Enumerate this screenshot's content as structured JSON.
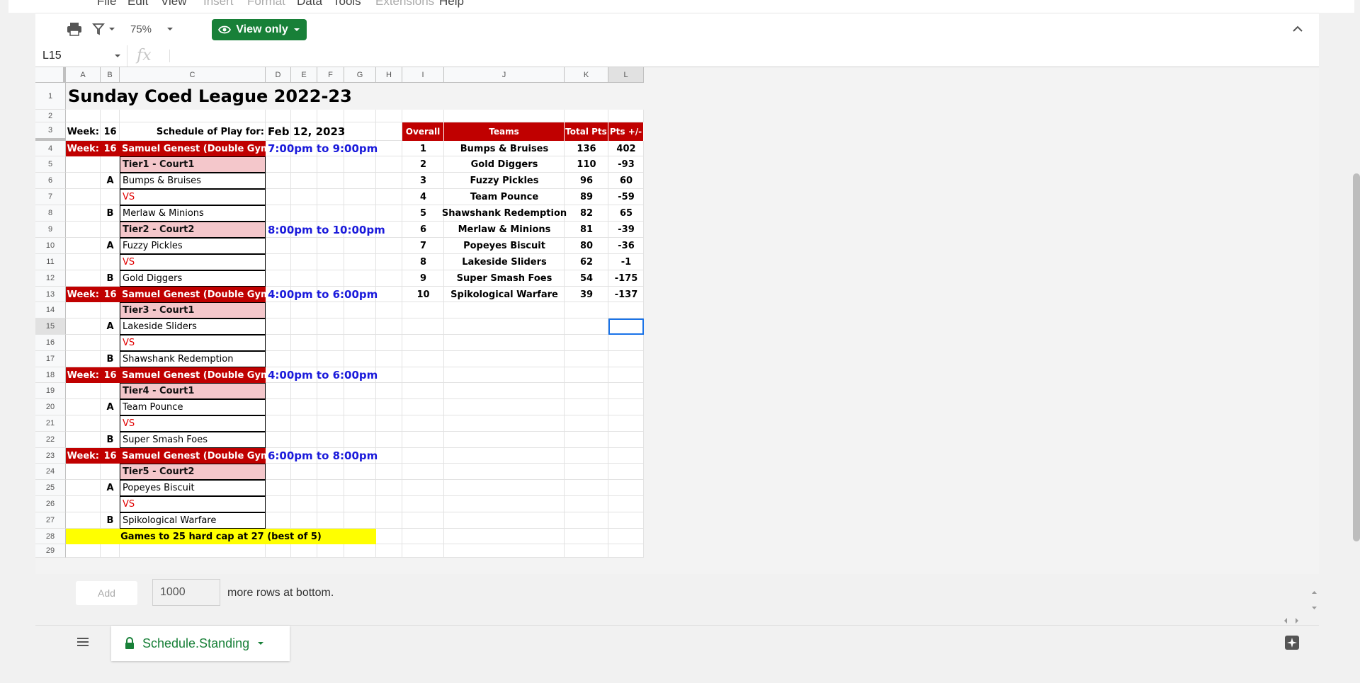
{
  "menu": {
    "items": [
      {
        "label": "File",
        "enabled": true
      },
      {
        "label": "Edit",
        "enabled": true
      },
      {
        "label": "View",
        "enabled": true
      },
      {
        "label": "Insert",
        "enabled": false
      },
      {
        "label": "Format",
        "enabled": false
      },
      {
        "label": "Data",
        "enabled": true
      },
      {
        "label": "Tools",
        "enabled": true
      },
      {
        "label": "Extensions",
        "enabled": false
      },
      {
        "label": "Help",
        "enabled": true
      }
    ]
  },
  "toolbar": {
    "zoom": "75%",
    "view_only_label": "View only"
  },
  "formula_bar": {
    "cell_ref": "L15",
    "fx_label": "fx"
  },
  "columns": [
    "A",
    "B",
    "C",
    "D",
    "E",
    "F",
    "G",
    "H",
    "I",
    "J",
    "K",
    "L"
  ],
  "rows": [
    "1",
    "2",
    "3",
    "4",
    "5",
    "6",
    "7",
    "8",
    "9",
    "10",
    "11",
    "12",
    "13",
    "14",
    "15",
    "16",
    "17",
    "18",
    "19",
    "20",
    "21",
    "22",
    "23",
    "24",
    "25",
    "26",
    "27",
    "28",
    "29"
  ],
  "sheet": {
    "title": "Sunday Coed League 2022-23",
    "week_label": "Week:",
    "week_value": "16",
    "schedule_label": "Schedule of Play for:",
    "schedule_date": "Feb 12, 2023",
    "blocks": [
      {
        "week_label": "Week:",
        "week": "16",
        "venue": "Samuel Genest (Double Gym)",
        "time": "7:00pm to 9:00pm",
        "tiers": [
          {
            "tier": "Tier1 - Court1",
            "a": "Bumps & Bruises",
            "vs": "VS",
            "b": "Merlaw & Minions"
          },
          {
            "tier": "Tier2 - Court2",
            "time": "8:00pm to 10:00pm",
            "a": "Fuzzy Pickles",
            "vs": "VS",
            "b": "Gold Diggers"
          }
        ]
      },
      {
        "week_label": "Week:",
        "week": "16",
        "venue": "Samuel Genest (Double Gym)",
        "time": "4:00pm to 6:00pm",
        "tiers": [
          {
            "tier": "Tier3 - Court1",
            "a": "Lakeside Sliders",
            "vs": "VS",
            "b": "Shawshank Redemption"
          }
        ]
      },
      {
        "week_label": "Week:",
        "week": "16",
        "venue": "Samuel Genest (Double Gym)",
        "time": "4:00pm to 6:00pm",
        "tiers": [
          {
            "tier": "Tier4 - Court1",
            "a": "Team Pounce",
            "vs": "VS",
            "b": "Super Smash Foes"
          }
        ]
      },
      {
        "week_label": "Week:",
        "week": "16",
        "venue": "Samuel Genest (Double Gym)",
        "time": "6:00pm to 8:00pm",
        "tiers": [
          {
            "tier": "Tier5 - Court2",
            "a": "Popeyes Biscuit",
            "vs": "VS",
            "b": "Spikological Warfare"
          }
        ]
      }
    ],
    "side_a": "A",
    "side_b": "B",
    "footer_note": "Games to 25 hard cap at 27 (best of 5)",
    "standings": {
      "headers": [
        "Overall",
        "Teams",
        "Total Pts",
        "Pts +/-"
      ],
      "rows": [
        [
          "1",
          "Bumps & Bruises",
          "136",
          "402"
        ],
        [
          "2",
          "Gold Diggers",
          "110",
          "-93"
        ],
        [
          "3",
          "Fuzzy Pickles",
          "96",
          "60"
        ],
        [
          "4",
          "Team Pounce",
          "89",
          "-59"
        ],
        [
          "5",
          "Shawshank Redemption",
          "82",
          "65"
        ],
        [
          "6",
          "Merlaw & Minions",
          "81",
          "-39"
        ],
        [
          "7",
          "Popeyes Biscuit",
          "80",
          "-36"
        ],
        [
          "8",
          "Lakeside Sliders",
          "62",
          "-1"
        ],
        [
          "9",
          "Super Smash Foes",
          "54",
          "-175"
        ],
        [
          "10",
          "Spikological Warfare",
          "39",
          "-137"
        ]
      ]
    }
  },
  "bottom": {
    "add_label": "Add",
    "rows_value": "1000",
    "more_rows_text": "more rows at bottom."
  },
  "tabs": {
    "active": "Schedule.Standing"
  },
  "colors": {
    "header_red": "#c00000",
    "tier_pink": "#f4c7cb",
    "time_blue": "#1a1adb",
    "note_yellow": "#ffff00",
    "brand_green": "#188038"
  }
}
